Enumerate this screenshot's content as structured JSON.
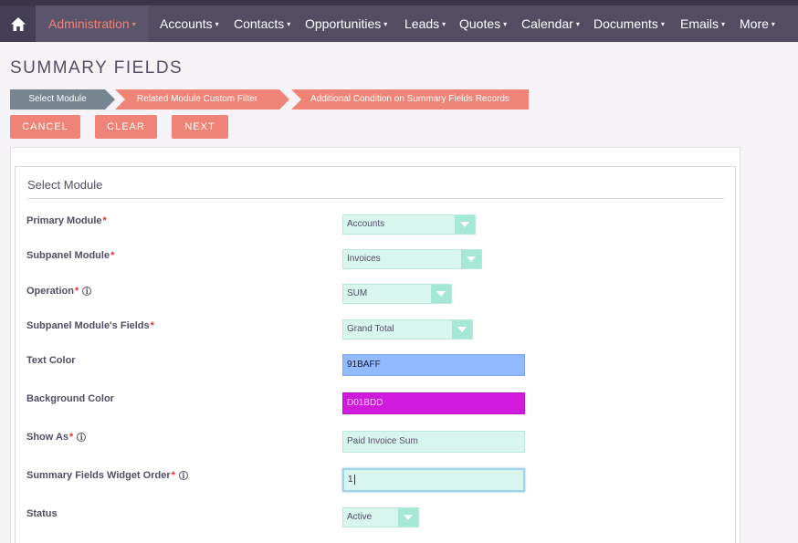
{
  "nav": {
    "items": [
      "Administration",
      "Accounts",
      "Contacts",
      "Opportunities",
      "Leads",
      "Quotes",
      "Calendar",
      "Documents",
      "Emails",
      "More"
    ]
  },
  "page_title": "SUMMARY FIELDS",
  "wizard": {
    "steps": [
      "Select Module",
      "Related Module Custom Filter",
      "Additional Condition on Summary Fields Records"
    ]
  },
  "buttons": {
    "cancel": "CANCEL",
    "clear": "CLEAR",
    "next": "NEXT"
  },
  "section_title": "Select Module",
  "form": {
    "primary_module": {
      "label": "Primary Module",
      "value": "Accounts"
    },
    "subpanel_module": {
      "label": "Subpanel Module",
      "value": "Invoices"
    },
    "operation": {
      "label": "Operation",
      "value": "SUM"
    },
    "subpanel_fields": {
      "label": "Subpanel Module's Fields",
      "value": "Grand Total"
    },
    "text_color": {
      "label": "Text Color",
      "value": "91BAFF"
    },
    "background_color": {
      "label": "Background Color",
      "value": "D01BDD"
    },
    "show_as": {
      "label": "Show As",
      "value": "Paid Invoice Sum"
    },
    "widget_order": {
      "label": "Summary Fields Widget Order",
      "value": "1"
    },
    "status": {
      "label": "Status",
      "value": "Active"
    }
  },
  "colors": {
    "nav_bg": "#534d64",
    "accent": "#f08377",
    "step_active": "#778591",
    "field_bg": "#d8f5ee",
    "text_color_swatch": "#91BAFF",
    "background_color_swatch": "#D01BDD"
  },
  "icons": {
    "home": "home-icon",
    "info": "info-icon"
  }
}
